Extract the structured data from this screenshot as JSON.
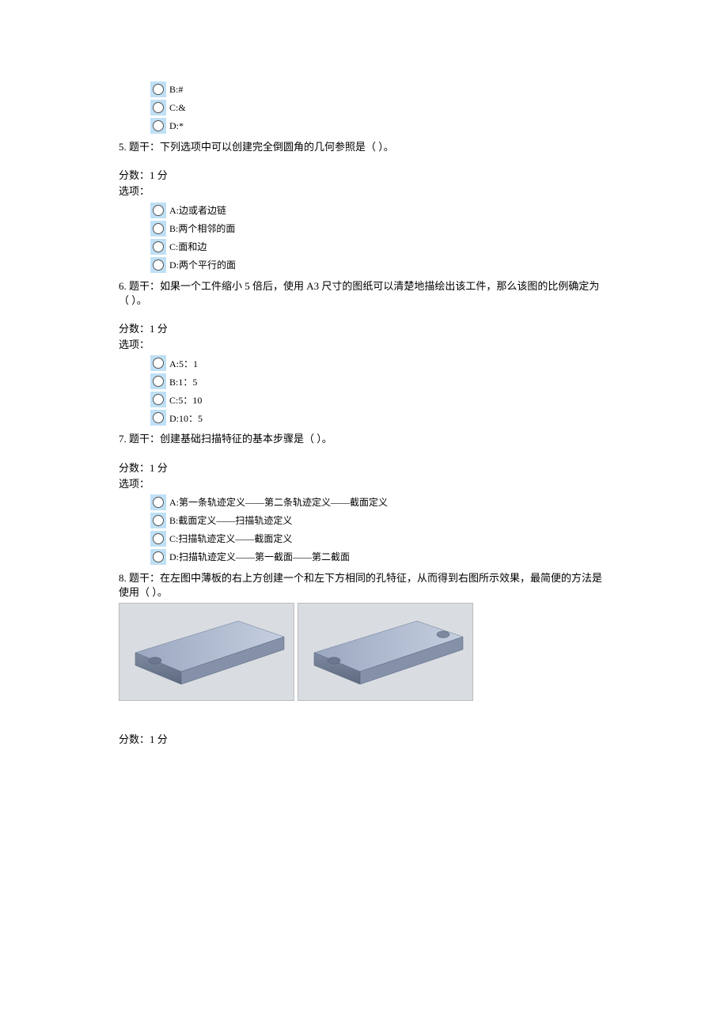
{
  "orphanOptions": [
    {
      "label": "B:#"
    },
    {
      "label": "C:&"
    },
    {
      "label": "D:*"
    }
  ],
  "q5": {
    "stem": "5. 题干：下列选项中可以创建完全倒圆角的几何参照是（ ）。",
    "score": "分数：1 分",
    "optsHeader": "选项：",
    "options": [
      {
        "label": "A:边或者边链"
      },
      {
        "label": "B:两个相邻的面"
      },
      {
        "label": "C:面和边"
      },
      {
        "label": "D:两个平行的面"
      }
    ]
  },
  "q6": {
    "stem": "6. 题干：如果一个工件缩小 5 倍后，使用 A3 尺寸的图纸可以清楚地描绘出该工件，那么该图的比例确定为（ ）。",
    "score": "分数：1 分",
    "optsHeader": "选项：",
    "options": [
      {
        "label": "A:5：1"
      },
      {
        "label": "B:1：5"
      },
      {
        "label": "C:5：10"
      },
      {
        "label": "D:10：5"
      }
    ]
  },
  "q7": {
    "stem": "7. 题干：创建基础扫描特征的基本步骤是（ ）。",
    "score": "分数：1 分",
    "optsHeader": "选项：",
    "options": [
      {
        "label": "A:第一条轨迹定义——第二条轨迹定义——截面定义"
      },
      {
        "label": "B:截面定义——扫描轨迹定义"
      },
      {
        "label": "C:扫描轨迹定义——截面定义"
      },
      {
        "label": "D:扫描轨迹定义——第一截面——第二截面"
      }
    ]
  },
  "q8": {
    "stem": "8. 题干：在左图中薄板的右上方创建一个和左下方相同的孔特征，从而得到右图所示效果，最简便的方法是使用（ ）。",
    "score": "分数：1 分"
  }
}
